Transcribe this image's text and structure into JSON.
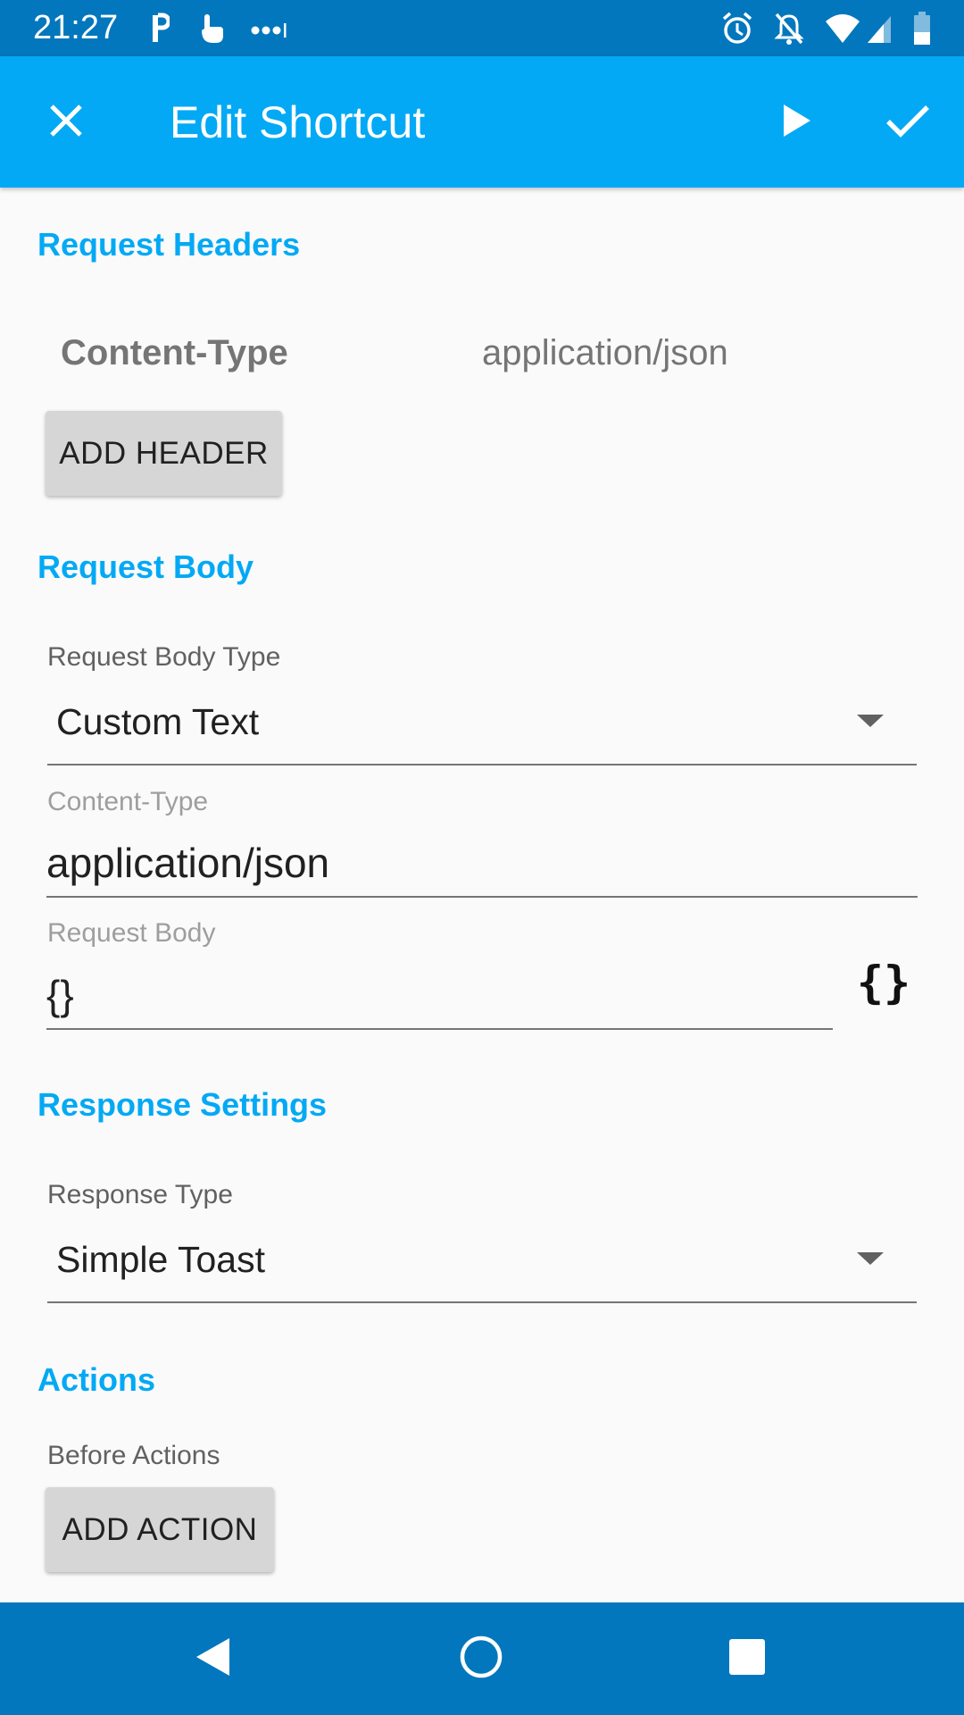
{
  "status_bar": {
    "time": "21:27",
    "left_icons": [
      "parking-icon",
      "touch-icon",
      "more-dots-icon"
    ],
    "right_icons": [
      "alarm-icon",
      "notifications-off-icon",
      "wifi-icon",
      "signal-icon",
      "battery-icon"
    ]
  },
  "app_bar": {
    "title": "Edit Shortcut",
    "close_icon": "close-icon",
    "run_icon": "play-icon",
    "save_icon": "check-icon"
  },
  "request_headers": {
    "section_title": "Request Headers",
    "headers": [
      {
        "key": "Content-Type",
        "value": "application/json"
      }
    ],
    "add_button_label": "ADD HEADER"
  },
  "request_body": {
    "section_title": "Request Body",
    "body_type_label": "Request Body Type",
    "body_type_value": "Custom Text",
    "content_type_label": "Content-Type",
    "content_type_value": "application/json",
    "body_label": "Request Body",
    "body_value": "{}",
    "code_button_label": "{}"
  },
  "response_settings": {
    "section_title": "Response Settings",
    "response_type_label": "Response Type",
    "response_type_value": "Simple Toast"
  },
  "actions": {
    "section_title": "Actions",
    "before_actions_label": "Before Actions",
    "add_action_label": "ADD ACTION"
  },
  "nav_bar": {
    "back_icon": "back-triangle-icon",
    "home_icon": "home-circle-icon",
    "recents_icon": "recents-square-icon"
  },
  "colors": {
    "status_bar": "#0277bd",
    "app_bar": "#03a9f4",
    "accent": "#03a9f4",
    "nav_bar": "#0277bd",
    "background": "#fafafa"
  }
}
